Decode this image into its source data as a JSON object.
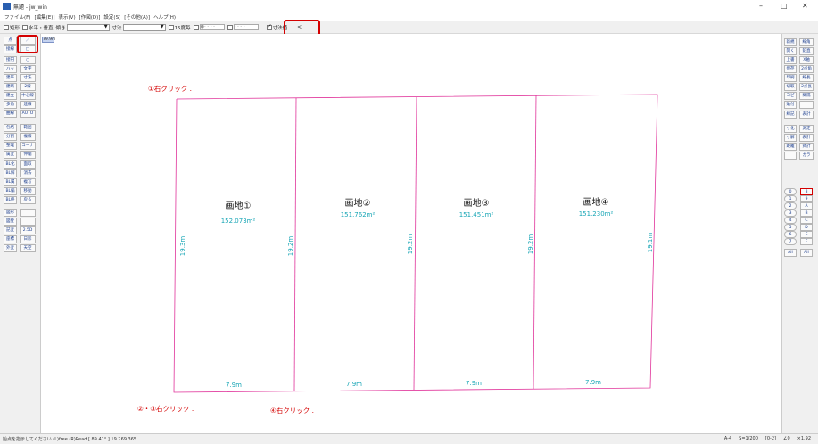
{
  "window": {
    "title": "無題 - jw_win"
  },
  "menu": [
    "ファイル(F)",
    "[編集(E)]",
    "表示(V)",
    "[作図(D)]",
    "設定(S)",
    "[その他(A)]",
    "ヘルプ(H)"
  ],
  "toolbar": {
    "check_rect": "矩形",
    "check_hv": "水平・垂直",
    "tilt_label": "傾き",
    "dim_label": "寸法",
    "check_15": "15度毎",
    "dim_value_label": "寸法値"
  },
  "scale_chip": "79.9m",
  "left_tools": [
    [
      "点",
      "／"
    ],
    [
      "接線",
      "□"
    ],
    [
      "接円",
      "○"
    ],
    [
      "ハッチ",
      "文字"
    ],
    [
      "建平",
      "寸法"
    ],
    [
      "建断",
      "2線"
    ],
    [
      "建立",
      "中心線"
    ],
    [
      "多角",
      "連線"
    ],
    [
      "曲線",
      "AUTO"
    ],
    [
      "包絡",
      "範囲"
    ],
    [
      "分割",
      "複線"
    ],
    [
      "整理",
      "コーナー"
    ],
    [
      "属変",
      "伸縮"
    ],
    [
      "BL化",
      "面取"
    ],
    [
      "BL解",
      "消去"
    ],
    [
      "BL属",
      "複写"
    ],
    [
      "BL編",
      "移動"
    ],
    [
      "BL終",
      "戻る"
    ],
    [
      "図形",
      ""
    ],
    [
      "図登",
      ""
    ],
    [
      "記変",
      "2.5D"
    ],
    [
      "座標",
      "日影"
    ],
    [
      "外変",
      "天空"
    ]
  ],
  "right_tools": [
    [
      "新規",
      "線角"
    ],
    [
      "開く",
      "鉛直"
    ],
    [
      "上書",
      "X軸"
    ],
    [
      "保存",
      "2点角"
    ],
    [
      "印刷",
      "線長"
    ],
    [
      "切取",
      "2点長"
    ],
    [
      "コピー",
      "間隔"
    ],
    [
      "貼付",
      ""
    ],
    [
      "線記",
      "表計"
    ],
    [
      "寸化",
      "測定"
    ],
    [
      "寸解",
      "表計"
    ],
    [
      "距離",
      "式計"
    ],
    [
      "",
      "ガラ"
    ]
  ],
  "layers": {
    "groups": [
      "0",
      "1",
      "2",
      "3",
      "4",
      "5",
      "6",
      "7",
      "8",
      "9",
      "A",
      "B",
      "C",
      "D",
      "E",
      "F"
    ],
    "all_label": "All"
  },
  "annotations": {
    "a1": "①右クリック .",
    "a23": "②・③右クリック .",
    "a4": "④右クリック ."
  },
  "lots": [
    {
      "name": "画地①",
      "area": "152.073m²",
      "left_dim": "19.3m",
      "bottom_dim": "7.9m"
    },
    {
      "name": "画地②",
      "area": "151.762m²",
      "left_dim": "19.2m",
      "bottom_dim": "7.9m"
    },
    {
      "name": "画地③",
      "area": "151.451m²",
      "left_dim": "19.2m",
      "bottom_dim": "7.9m"
    },
    {
      "name": "画地④",
      "area": "151.230m²",
      "left_dim": "19.2m",
      "bottom_dim": "7.9m"
    }
  ],
  "right_dim": "19.1m",
  "status": {
    "message": "始点を指示してください (L)free (R)Read [ 89.41° ] 19.269.365",
    "paper": "A-4",
    "scale": "S=1/200",
    "layer": "[0-2]",
    "angle": "∠0",
    "zoom": "×1.92"
  },
  "colors": {
    "lot_line": "#e0339a",
    "dim_text": "#16a5b5",
    "annotation": "#d40000",
    "highlight": "#d40000"
  }
}
